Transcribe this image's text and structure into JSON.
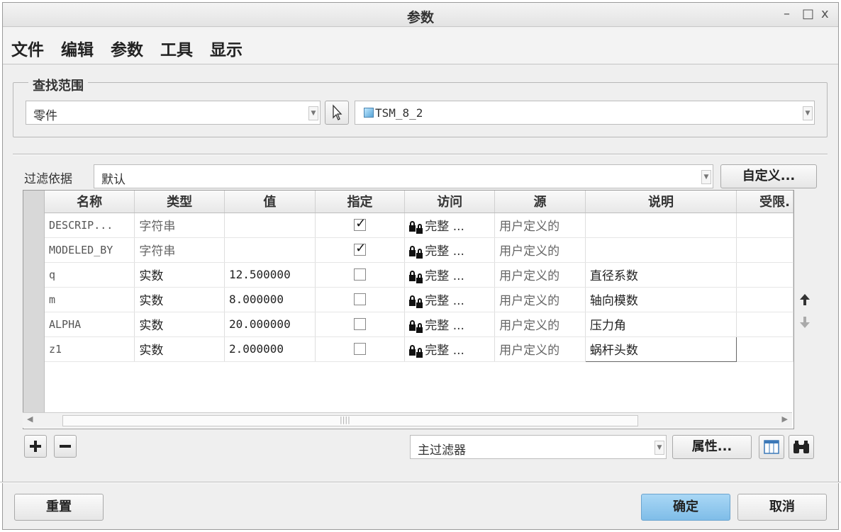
{
  "window": {
    "title": "参数",
    "controls": [
      "–",
      "□",
      "x"
    ]
  },
  "menu": [
    "文件",
    "编辑",
    "参数",
    "工具",
    "显示"
  ],
  "scope": {
    "legend": "查找范围",
    "type_value": "零件",
    "model_value": "TSM_8_2"
  },
  "filter": {
    "label": "过滤依据",
    "value": "默认",
    "customize_label": "自定义..."
  },
  "table": {
    "headers": [
      "名称",
      "类型",
      "值",
      "指定",
      "访问",
      "源",
      "说明",
      "受限."
    ],
    "rows": [
      {
        "name": "DESCRIP...",
        "type": "字符串",
        "value": "",
        "designated": true,
        "access": "完整 ...",
        "source": "用户定义的",
        "description": ""
      },
      {
        "name": "MODELED_BY",
        "type": "字符串",
        "value": "",
        "designated": true,
        "access": "完整 ...",
        "source": "用户定义的",
        "description": ""
      },
      {
        "name": "q",
        "type": "实数",
        "value": "12.500000",
        "designated": false,
        "access": "完整 ...",
        "source": "用户定义的",
        "description": "直径系数"
      },
      {
        "name": "m",
        "type": "实数",
        "value": "8.000000",
        "designated": false,
        "access": "完整 ...",
        "source": "用户定义的",
        "description": "轴向模数"
      },
      {
        "name": "ALPHA",
        "type": "实数",
        "value": "20.000000",
        "designated": false,
        "access": "完整 ...",
        "source": "用户定义的",
        "description": "压力角"
      },
      {
        "name": "z1",
        "type": "实数",
        "value": "2.000000",
        "designated": false,
        "access": "完整 ...",
        "source": "用户定义的",
        "description": "蜗杆头数"
      }
    ]
  },
  "bottom_bar": {
    "main_filter": "主过滤器",
    "properties_label": "属性..."
  },
  "footer": {
    "reset_label": "重置",
    "ok_label": "确定",
    "cancel_label": "取消"
  },
  "colors": {
    "ok_button": "#8ec8ee"
  }
}
